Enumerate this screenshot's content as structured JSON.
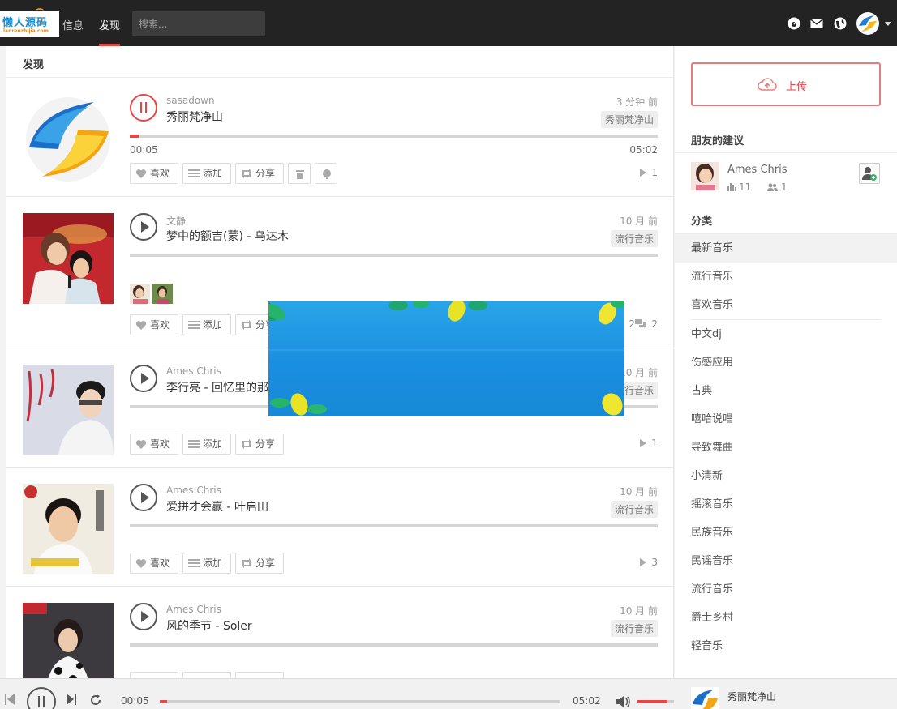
{
  "nav": {
    "logo_text": "懒人源码",
    "logo_sub": "lanrenzhijia.com",
    "items": [
      {
        "label": "信息",
        "active": false
      },
      {
        "label": "发现",
        "active": true
      }
    ],
    "search_placeholder": "搜索...",
    "icons": [
      "dashboard-icon",
      "mail-icon",
      "globe-icon"
    ],
    "accent": "#e54646"
  },
  "main": {
    "title": "发现",
    "feed": [
      {
        "author": "sasadown",
        "title": "秀丽梵净山",
        "time": "3 分钟 前",
        "tag": "秀丽梵净山",
        "state": "playing",
        "progress": 0.017,
        "current": "00:05",
        "duration": "05:02",
        "actions": {
          "like": "喜欢",
          "add": "添加",
          "share": "分享"
        },
        "plays": "1"
      },
      {
        "author": "文静",
        "title": "梦中的额吉(蒙) - 乌达木",
        "time": "10 月 前",
        "tag": "流行音乐",
        "state": "paused",
        "actions": {
          "like": "喜欢",
          "add": "添加",
          "share": "分享"
        },
        "plays": "2",
        "comments": "2"
      },
      {
        "author": "Ames Chris",
        "title": "李行亮 - 回忆里的那个人",
        "time": "10 月 前",
        "tag": "流行音乐",
        "state": "paused",
        "actions": {
          "like": "喜欢",
          "add": "添加",
          "share": "分享"
        },
        "plays": "1"
      },
      {
        "author": "Ames Chris",
        "title": "爱拼才会赢 - 叶启田",
        "time": "10 月 前",
        "tag": "流行音乐",
        "state": "paused",
        "actions": {
          "like": "喜欢",
          "add": "添加",
          "share": "分享"
        },
        "plays": "3"
      },
      {
        "author": "Ames Chris",
        "title": "风的季节 - Soler",
        "time": "10 月 前",
        "tag": "流行音乐",
        "state": "paused"
      }
    ]
  },
  "sidebar": {
    "upload_label": "上传",
    "friends_heading": "朋友的建议",
    "friend": {
      "name": "Ames Chris",
      "songs": "11",
      "followers": "1"
    },
    "categories_heading": "分类",
    "categories": [
      "最新音乐",
      "流行音乐",
      "喜欢音乐",
      "中文dj",
      "伤感应用",
      "古典",
      "嘻哈说唱",
      "导致舞曲",
      "小清新",
      "摇滚音乐",
      "民族音乐",
      "民谣音乐",
      "流行音乐",
      "爵士乡村",
      "轻音乐"
    ],
    "active_category": "最新音乐"
  },
  "player": {
    "current": "00:05",
    "duration": "05:02",
    "progress": 0.017,
    "volume": 0.82,
    "title": "秀丽梵净山"
  }
}
